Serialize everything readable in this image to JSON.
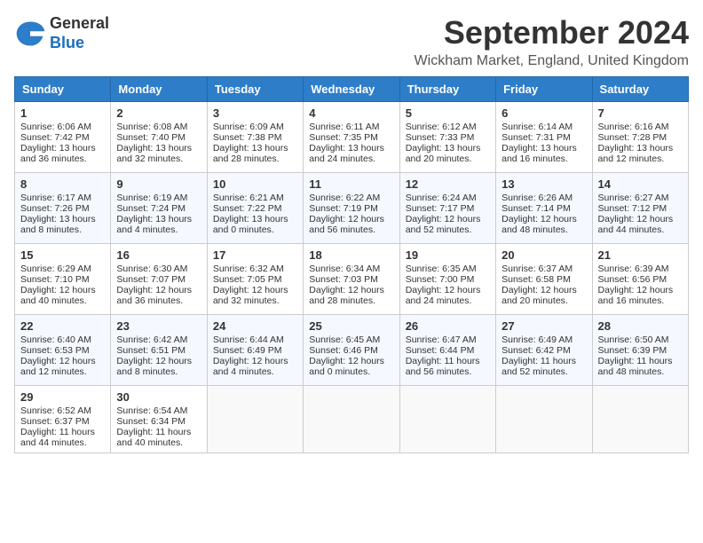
{
  "logo": {
    "line1": "General",
    "line2": "Blue"
  },
  "title": "September 2024",
  "subtitle": "Wickham Market, England, United Kingdom",
  "weekdays": [
    "Sunday",
    "Monday",
    "Tuesday",
    "Wednesday",
    "Thursday",
    "Friday",
    "Saturday"
  ],
  "weeks": [
    [
      {
        "day": 1,
        "sunrise": "6:06 AM",
        "sunset": "7:42 PM",
        "daylight": "13 hours and 36 minutes."
      },
      {
        "day": 2,
        "sunrise": "6:08 AM",
        "sunset": "7:40 PM",
        "daylight": "13 hours and 32 minutes."
      },
      {
        "day": 3,
        "sunrise": "6:09 AM",
        "sunset": "7:38 PM",
        "daylight": "13 hours and 28 minutes."
      },
      {
        "day": 4,
        "sunrise": "6:11 AM",
        "sunset": "7:35 PM",
        "daylight": "13 hours and 24 minutes."
      },
      {
        "day": 5,
        "sunrise": "6:12 AM",
        "sunset": "7:33 PM",
        "daylight": "13 hours and 20 minutes."
      },
      {
        "day": 6,
        "sunrise": "6:14 AM",
        "sunset": "7:31 PM",
        "daylight": "13 hours and 16 minutes."
      },
      {
        "day": 7,
        "sunrise": "6:16 AM",
        "sunset": "7:28 PM",
        "daylight": "13 hours and 12 minutes."
      }
    ],
    [
      {
        "day": 8,
        "sunrise": "6:17 AM",
        "sunset": "7:26 PM",
        "daylight": "13 hours and 8 minutes."
      },
      {
        "day": 9,
        "sunrise": "6:19 AM",
        "sunset": "7:24 PM",
        "daylight": "13 hours and 4 minutes."
      },
      {
        "day": 10,
        "sunrise": "6:21 AM",
        "sunset": "7:22 PM",
        "daylight": "13 hours and 0 minutes."
      },
      {
        "day": 11,
        "sunrise": "6:22 AM",
        "sunset": "7:19 PM",
        "daylight": "12 hours and 56 minutes."
      },
      {
        "day": 12,
        "sunrise": "6:24 AM",
        "sunset": "7:17 PM",
        "daylight": "12 hours and 52 minutes."
      },
      {
        "day": 13,
        "sunrise": "6:26 AM",
        "sunset": "7:14 PM",
        "daylight": "12 hours and 48 minutes."
      },
      {
        "day": 14,
        "sunrise": "6:27 AM",
        "sunset": "7:12 PM",
        "daylight": "12 hours and 44 minutes."
      }
    ],
    [
      {
        "day": 15,
        "sunrise": "6:29 AM",
        "sunset": "7:10 PM",
        "daylight": "12 hours and 40 minutes."
      },
      {
        "day": 16,
        "sunrise": "6:30 AM",
        "sunset": "7:07 PM",
        "daylight": "12 hours and 36 minutes."
      },
      {
        "day": 17,
        "sunrise": "6:32 AM",
        "sunset": "7:05 PM",
        "daylight": "12 hours and 32 minutes."
      },
      {
        "day": 18,
        "sunrise": "6:34 AM",
        "sunset": "7:03 PM",
        "daylight": "12 hours and 28 minutes."
      },
      {
        "day": 19,
        "sunrise": "6:35 AM",
        "sunset": "7:00 PM",
        "daylight": "12 hours and 24 minutes."
      },
      {
        "day": 20,
        "sunrise": "6:37 AM",
        "sunset": "6:58 PM",
        "daylight": "12 hours and 20 minutes."
      },
      {
        "day": 21,
        "sunrise": "6:39 AM",
        "sunset": "6:56 PM",
        "daylight": "12 hours and 16 minutes."
      }
    ],
    [
      {
        "day": 22,
        "sunrise": "6:40 AM",
        "sunset": "6:53 PM",
        "daylight": "12 hours and 12 minutes."
      },
      {
        "day": 23,
        "sunrise": "6:42 AM",
        "sunset": "6:51 PM",
        "daylight": "12 hours and 8 minutes."
      },
      {
        "day": 24,
        "sunrise": "6:44 AM",
        "sunset": "6:49 PM",
        "daylight": "12 hours and 4 minutes."
      },
      {
        "day": 25,
        "sunrise": "6:45 AM",
        "sunset": "6:46 PM",
        "daylight": "12 hours and 0 minutes."
      },
      {
        "day": 26,
        "sunrise": "6:47 AM",
        "sunset": "6:44 PM",
        "daylight": "11 hours and 56 minutes."
      },
      {
        "day": 27,
        "sunrise": "6:49 AM",
        "sunset": "6:42 PM",
        "daylight": "11 hours and 52 minutes."
      },
      {
        "day": 28,
        "sunrise": "6:50 AM",
        "sunset": "6:39 PM",
        "daylight": "11 hours and 48 minutes."
      }
    ],
    [
      {
        "day": 29,
        "sunrise": "6:52 AM",
        "sunset": "6:37 PM",
        "daylight": "11 hours and 44 minutes."
      },
      {
        "day": 30,
        "sunrise": "6:54 AM",
        "sunset": "6:34 PM",
        "daylight": "11 hours and 40 minutes."
      },
      null,
      null,
      null,
      null,
      null
    ]
  ]
}
